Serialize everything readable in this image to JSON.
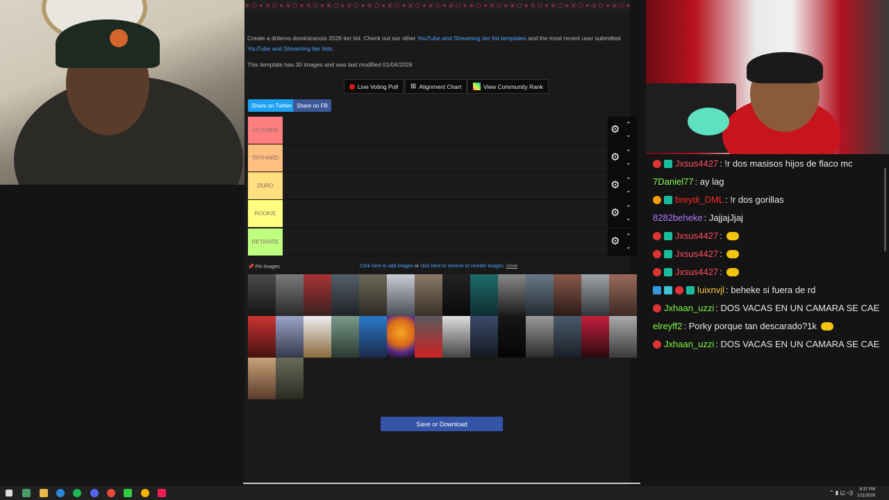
{
  "browser": {
    "top_strip_text": "⦿ ◎ ✕ ⦿ ◎ ✕ ⦿ ◎ ✕ ⦿ ◎ ✕ ⦿ ◎ ✕ ⦿ ◎ ✕ ⦿ ◎ ✕ ⦿ ◎ ✕ ⦿ ◎ ✕ ⦿ ◎ ✕ ⦿ ◎ ✕ ⦿ ◎ ✕ ⦿ ◎ ✕ ⦿ ◎ ✕ ⦿ ◎ ✕ ⦿ ◎ ✕ ⦿ ◎ ✕ ⦿ ◎ ✕ ⦿ ◎ ✕",
    "desc_prefix": "Create a drileros dominicanois 2026 tier list. Check out our other",
    "desc_link1": "YouTube and Streaming tier list templates",
    "desc_middle": "and the most recent user submitted",
    "desc_link2": "YouTube and Streaming tier lists",
    "desc_end": ".",
    "modified": "This template has 30 images and was last modified 01/04/2026",
    "live_voting": "Live Voting Poll",
    "alignment": "Alignment Chart",
    "community_rank": "View Community Rank",
    "share_twitter": "Share on Twitter",
    "share_fb": "Share on FB",
    "tiers": [
      {
        "label": "LEYENDA",
        "color": "#ff7f7f"
      },
      {
        "label": "TRYHARD",
        "color": "#ffbf7f"
      },
      {
        "label": "DURO",
        "color": "#ffdf7f"
      },
      {
        "label": "ROOKIE",
        "color": "#ffff7f"
      },
      {
        "label": "RETIRATE",
        "color": "#bfff7f"
      }
    ],
    "gear_icon": "⚙",
    "up_icon": "⌃",
    "down_icon": "⌄",
    "pin_images": "Pin Images",
    "add_images": "Click here to add images",
    "or": "or",
    "remove_images": "click here to remove or reorder images.",
    "close": "close",
    "save_download": "Save or Download"
  },
  "chat": [
    {
      "user": "Jxsus4427",
      "color": "#ff4d5e",
      "text": ": !r dos masisos hijos de flaco mc",
      "badges": [
        "#d33",
        "#1abc9c"
      ],
      "emote": false
    },
    {
      "user": "7Daniel77",
      "color": "#8bff5a",
      "text": ": ay lag",
      "badges": [],
      "emote": false
    },
    {
      "user": "breydi_DML",
      "color": "#ff2a2a",
      "text": ": !r dos gorillas",
      "badges": [
        "#f39c12",
        "#1abc9c"
      ],
      "emote": false
    },
    {
      "user": "8282beheke",
      "color": "#b37bff",
      "text": ": JajjajJjaj",
      "badges": [],
      "emote": false
    },
    {
      "user": "Jxsus4427",
      "color": "#ff4d5e",
      "text": ":",
      "badges": [
        "#d33",
        "#1abc9c"
      ],
      "emote": true
    },
    {
      "user": "Jxsus4427",
      "color": "#ff4d5e",
      "text": ":",
      "badges": [
        "#d33",
        "#1abc9c"
      ],
      "emote": true
    },
    {
      "user": "Jxsus4427",
      "color": "#ff4d5e",
      "text": ":",
      "badges": [
        "#d33",
        "#1abc9c"
      ],
      "emote": true
    },
    {
      "user": "luixnvjl",
      "color": "#f7c744",
      "text": ": beheke si fuera de rd",
      "badges": [
        "#3498db",
        "#3ec1d3",
        "#d33",
        "#1abc9c"
      ],
      "emote": false
    },
    {
      "user": "Jxhaan_uzzi",
      "color": "#7ef542",
      "text": ": DOS VACAS EN UN CAMARA SE CAE",
      "badges": [
        "#d33"
      ],
      "emote": false
    },
    {
      "user": "elreyff2",
      "color": "#7ef542",
      "text": ": Porky porque tan descarado?1k",
      "badges": [],
      "emote": true
    },
    {
      "user": "Jxhaan_uzzi",
      "color": "#7ef542",
      "text": ": DOS VACAS EN UN CAMARA SE CAE",
      "badges": [
        "#d33"
      ],
      "emote": false
    }
  ],
  "taskbar": {
    "time": "8:37 PM",
    "date": "1/11/2026",
    "tray_icons": "⌃ ▮ ◱ ◁)"
  }
}
